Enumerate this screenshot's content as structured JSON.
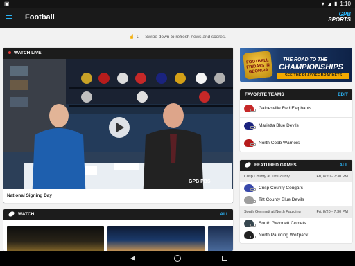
{
  "status_bar": {
    "left_icon": "android-notification-icon",
    "time": "1:10",
    "icons": [
      "wifi-icon",
      "signal-icon",
      "battery-icon"
    ]
  },
  "app_bar": {
    "title": "Football",
    "logo_text_1": "GPB",
    "logo_text_2": "SPORTS"
  },
  "refresh_hint": "Swipe down to refresh news and scores.",
  "watch_live": {
    "header": "WATCH LIVE",
    "caption": "National Signing Day",
    "video_logo": "GPB PBS"
  },
  "watch": {
    "header": "WATCH",
    "action": "ALL"
  },
  "promo_banner": {
    "badge": "FOOTBALL FRIDAYS IN GEORGIA",
    "line1": "THE ROAD TO THE",
    "line2": "CHAMPIONSHIPS",
    "cta": "SEE THE PLAYOFF BRACKETS"
  },
  "favorite_teams": {
    "header": "FAVORITE TEAMS",
    "action": "EDIT",
    "teams": [
      {
        "name": "Gainesville Red Elephants",
        "color": "#c62828"
      },
      {
        "name": "Marietta Blue Devils",
        "color": "#1a237e"
      },
      {
        "name": "North Cobb Warriors",
        "color": "#b71c1c"
      }
    ]
  },
  "featured_games": {
    "header": "FEATURED GAMES",
    "action": "ALL",
    "games": [
      {
        "matchup": "Crisp County at Tift County",
        "date": "Fri, 8/20 - 7:30 PM",
        "team1": "Crisp County Cougars",
        "team1_color": "#3949ab",
        "team2": "Tift County Blue Devils",
        "team2_color": "#9e9e9e"
      },
      {
        "matchup": "South Gwinnett at North Paulding",
        "date": "Fri, 8/20 - 7:30 PM",
        "team1": "South Gwinnett Comets",
        "team1_color": "#37474f",
        "team2": "North Paulding Wolfpack",
        "team2_color": "#212121"
      }
    ]
  },
  "colors": {
    "accent": "#2bb3f5",
    "header_bg": "#1c1c1c",
    "live_red": "#e53935"
  }
}
